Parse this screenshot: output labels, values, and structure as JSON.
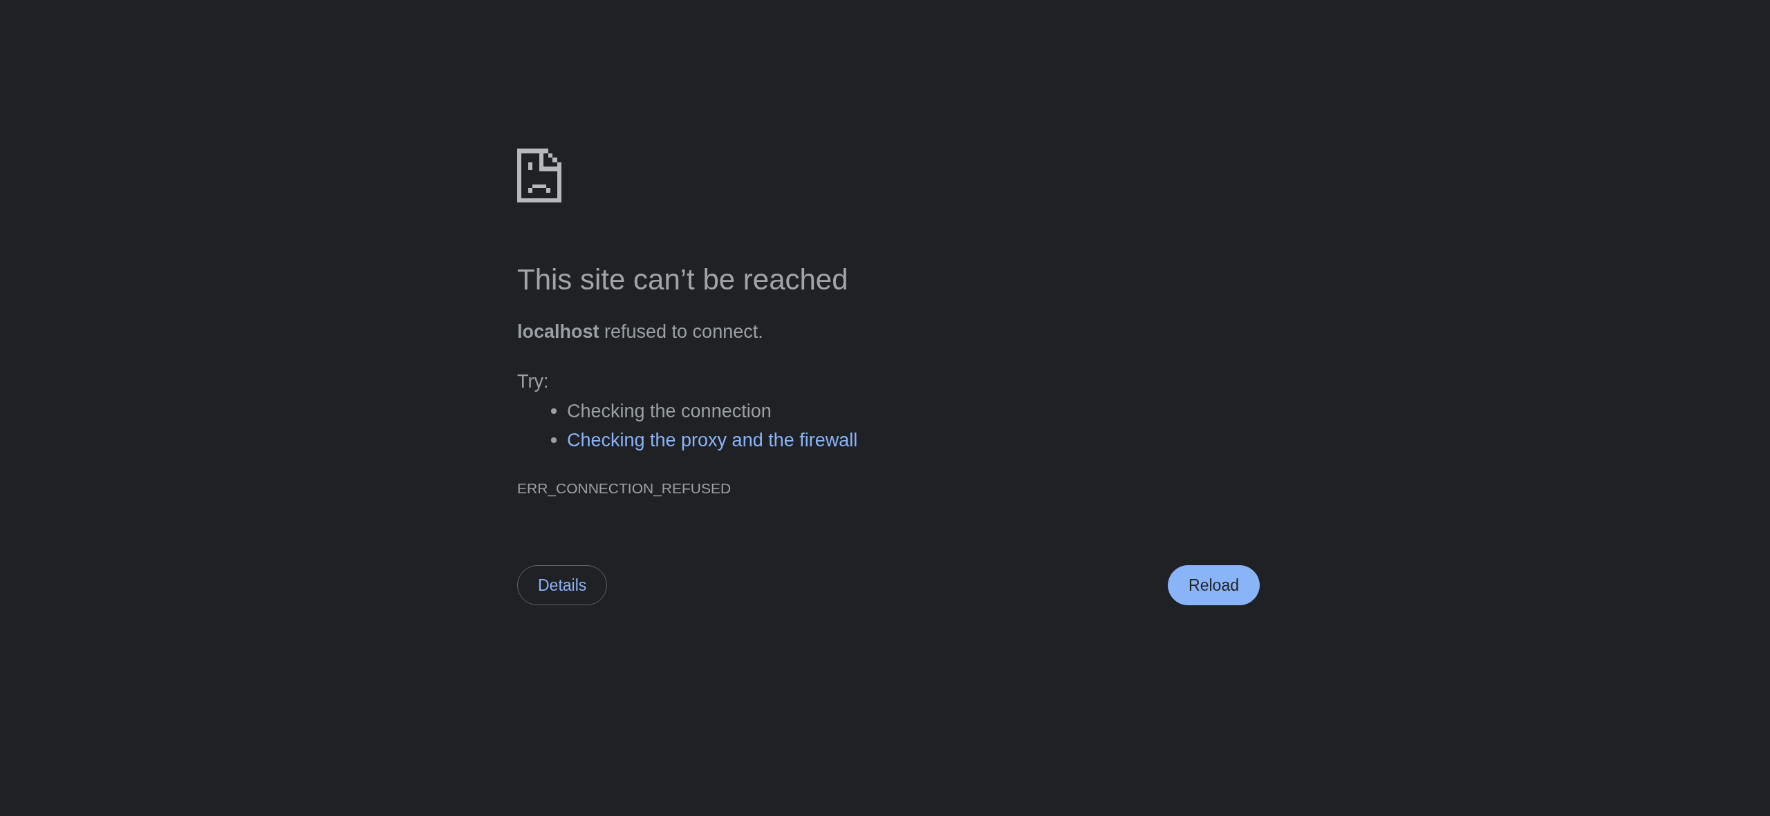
{
  "heading": "This site can’t be reached",
  "message": "**localhost** refused to connect.",
  "suggestions": {
    "label": "Try:",
    "items": [
      {
        "text": "Checking the connection",
        "kind": "text"
      },
      {
        "text": "Checking the proxy and the firewall",
        "kind": "link"
      }
    ]
  },
  "error_code": "ERR_CONNECTION_REFUSED",
  "buttons": [
    {
      "label": "Details",
      "kind": "secondary"
    },
    {
      "label": "Reload",
      "kind": "primary"
    }
  ]
}
